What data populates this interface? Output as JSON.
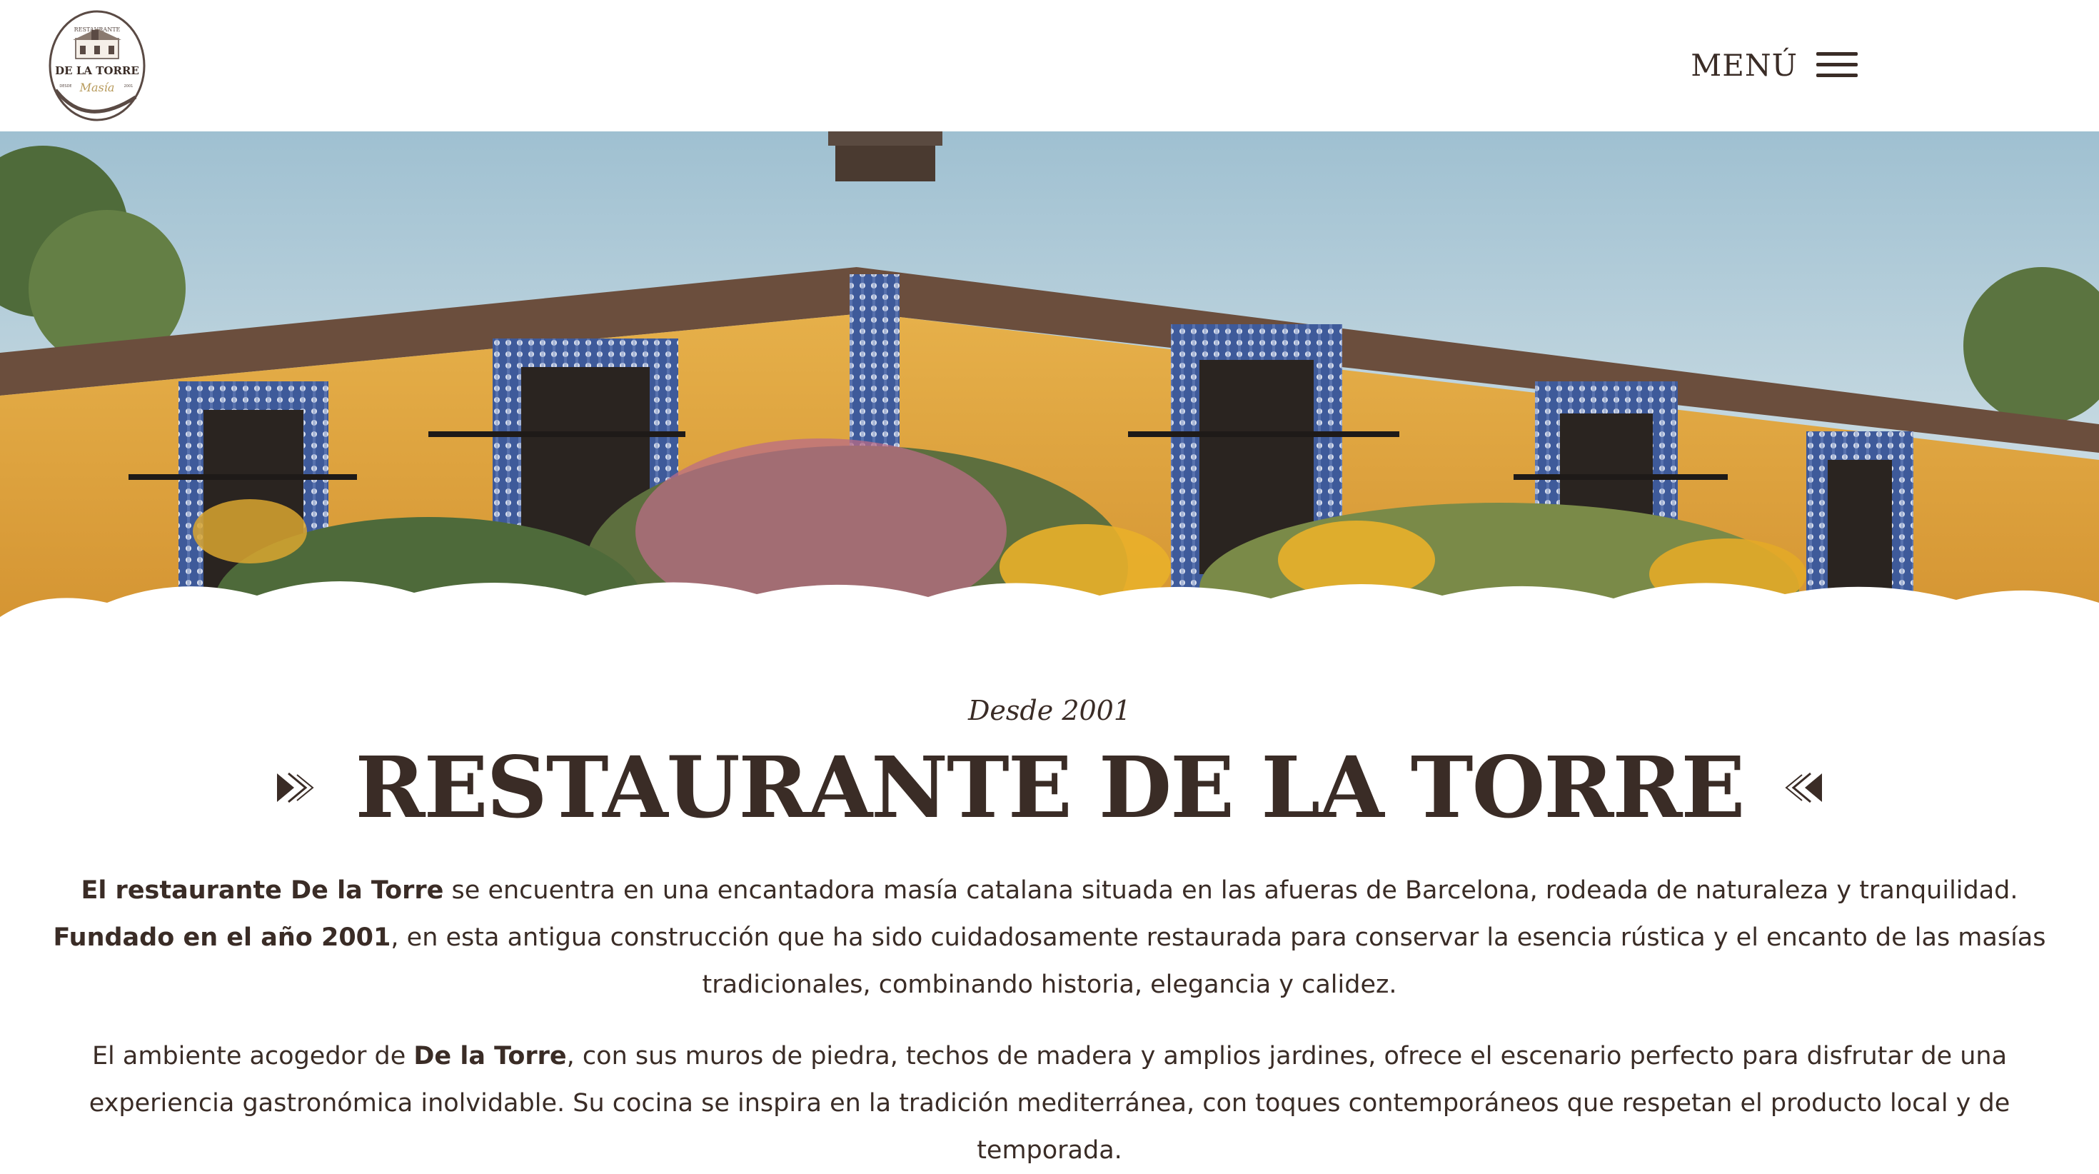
{
  "header": {
    "logo": {
      "top_text": "RESTAURANTE",
      "name": "DE LA TORRE",
      "script": "Masía",
      "left_badge": "DESDE",
      "right_badge": "2001"
    },
    "menu_label": "MENÚ"
  },
  "hero": {
    "alt": "Masía amarilla con azulejos y jardín"
  },
  "intro": {
    "tagline": "Desde 2001",
    "title": "RESTAURANTE DE LA TORRE",
    "p1": {
      "b1": "El restaurante De la Torre",
      "t1": " se encuentra en una encantadora masía catalana situada en las afueras de Barcelona, rodeada de naturaleza y tranquilidad. ",
      "b2": "Fundado en el año 2001",
      "t2": ", en esta antigua construcción que ha sido cuidadosamente restaurada para conservar la esencia rústica y el encanto de las masías tradicionales, combinando historia, elegancia y calidez."
    },
    "p2": {
      "t1": "El ambiente acogedor de ",
      "b1": "De la Torre",
      "t2": ", con sus muros de piedra, techos de madera y amplios jardines, ofrece el escenario perfecto para disfrutar de una experiencia gastronómica inolvidable. Su cocina se inspira en la tradición mediterránea, con toques contemporáneos que respetan el producto local y de temporada."
    }
  },
  "colors": {
    "text": "#3a2c26",
    "facade": "#e2a53b",
    "tile_blue": "#3e5a9a",
    "sky": "#c9dbe3"
  }
}
